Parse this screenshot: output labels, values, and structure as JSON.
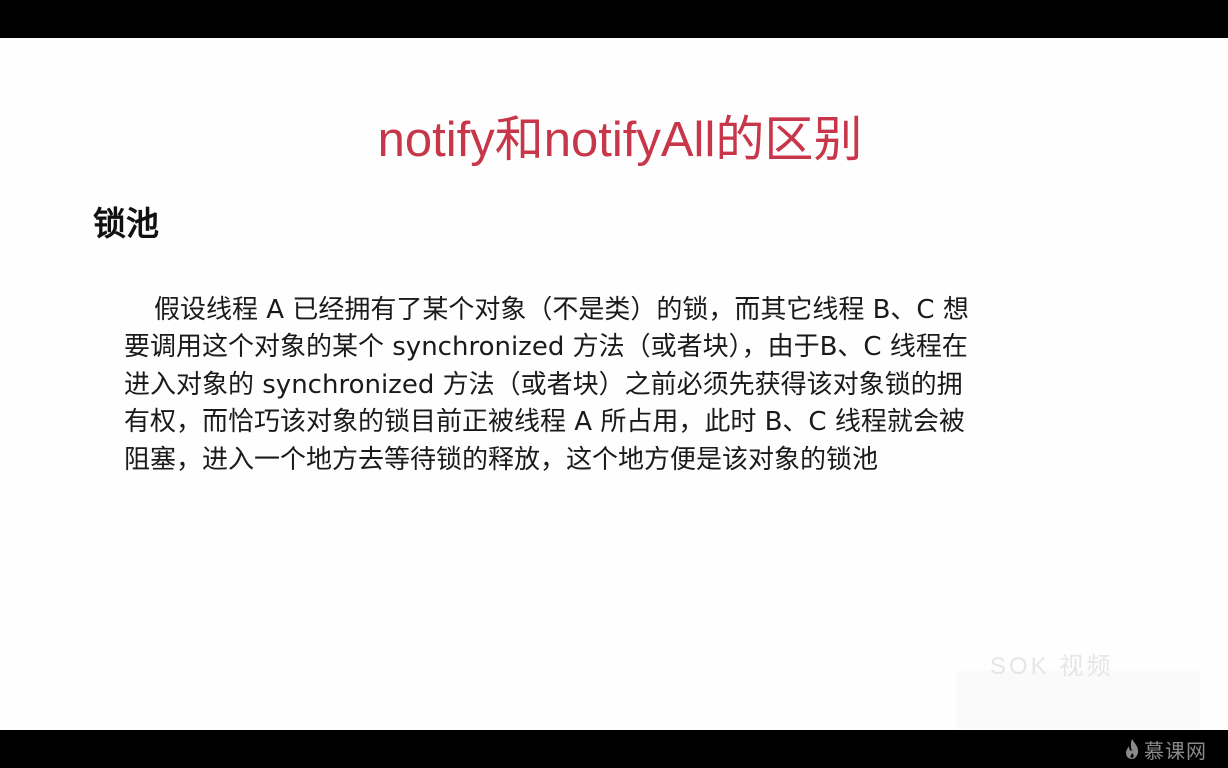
{
  "slide": {
    "title": "notify和notifyAll的区别",
    "heading": "锁池",
    "paragraph_lines": [
      "假设线程 A 已经拥有了某个对象（不是类）的锁，而其它线程 B、C 想",
      "要调用这个对象的某个 synchronized 方法（或者块），由于B、C 线程在",
      "进入对象的 synchronized 方法（或者块）之前必须先获得该对象锁的拥",
      "有权，而恰巧该对象的锁目前正被线程 A 所占用，此时 B、C 线程就会被",
      "阻塞，进入一个地方去等待锁的释放，这个地方便是该对象的锁池"
    ]
  },
  "watermark": {
    "text": "SOK 视频"
  },
  "logo": {
    "text": "慕课网",
    "icon": "flame-icon",
    "color": "#8a8a8a"
  },
  "colors": {
    "title": "#c8364a",
    "background": "#fefefe",
    "bars": "#000000"
  }
}
